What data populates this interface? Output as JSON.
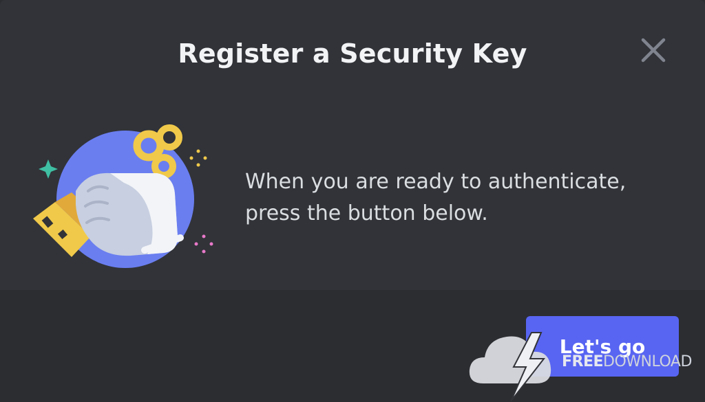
{
  "modal": {
    "title": "Register a Security Key",
    "body_text_line1": "When you are ready to authenticate,",
    "body_text_line2": "press the button below.",
    "primary_button_label": "Let's go",
    "close_icon": "close-icon",
    "illustration_icon": "security-key-hand-illustration"
  },
  "watermark": {
    "part1": "FREE",
    "part2": "DOWNLOAD",
    "icon": "cloud-lightning-icon"
  },
  "colors": {
    "modal_bg": "#313338",
    "footer_bg": "#2b2d31",
    "title": "#f2f3f5",
    "body_text": "#dbdee1",
    "primary": "#5865f2",
    "close_icon": "#80848e",
    "key_gold": "#f0c94a",
    "circle_blue": "#6a7ef0"
  }
}
